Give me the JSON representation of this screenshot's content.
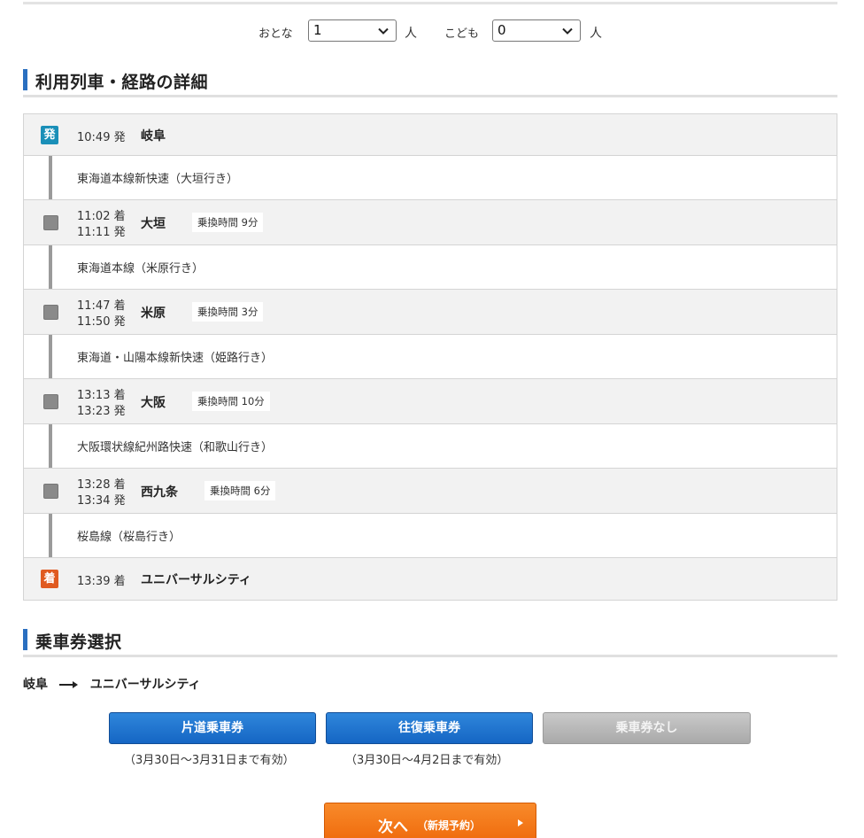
{
  "passengers": {
    "adult_label": "おとな",
    "adult_value": "1",
    "child_label": "こども",
    "child_value": "0",
    "unit": "人"
  },
  "route_section": {
    "title": "利用列車・経路の詳細",
    "departure": {
      "badge": "発",
      "time": "10:49 発",
      "station": "岐阜"
    },
    "lines": [
      "東海道本線新快速（大垣行き）",
      "東海道本線（米原行き）",
      "東海道・山陽本線新快速（姫路行き）",
      "大阪環状線紀州路快速（和歌山行き）",
      "桜島線（桜島行き）"
    ],
    "transfers": [
      {
        "arr": "11:02 着",
        "dep": "11:11 発",
        "station": "大垣",
        "xfer": "乗換時間 9分"
      },
      {
        "arr": "11:47 着",
        "dep": "11:50 発",
        "station": "米原",
        "xfer": "乗換時間 3分"
      },
      {
        "arr": "13:13 着",
        "dep": "13:23 発",
        "station": "大阪",
        "xfer": "乗換時間 10分"
      },
      {
        "arr": "13:28 着",
        "dep": "13:34 発",
        "station": "西九条",
        "xfer": "乗換時間 6分"
      }
    ],
    "arrival": {
      "badge": "着",
      "time": "13:39 着",
      "station": "ユニバーサルシティ"
    }
  },
  "ticket_section": {
    "title": "乗車券選択",
    "from": "岐阜",
    "to": "ユニバーサルシティ",
    "oneway_label": "片道乗車券",
    "oneway_valid": "（3月30日～3月31日まで有効）",
    "round_label": "往復乗車券",
    "round_valid": "（3月30日～4月2日まで有効）",
    "none_label": "乗車券なし"
  },
  "next_button": {
    "main": "次へ",
    "sub": "（新規予約）"
  },
  "colors": {
    "accent_blue": "#2a6fc0",
    "depart_badge": "#1a8fb8",
    "arrive_badge": "#e05a20",
    "next_orange": "#f27a16"
  }
}
